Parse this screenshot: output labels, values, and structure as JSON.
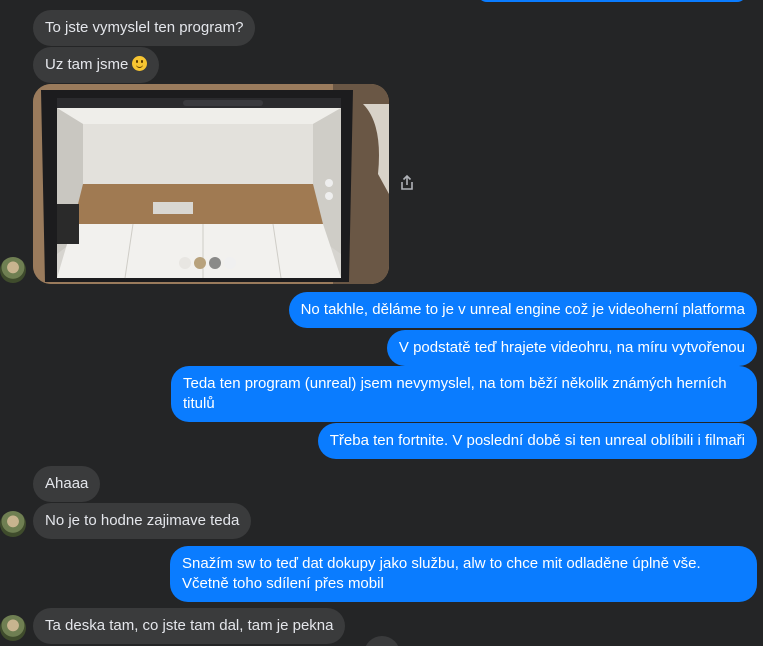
{
  "messages": {
    "m1": "To jste vymyslel ten program?",
    "m2": "Uz tam jsme",
    "m3": "No takhle, děláme to je v unreal engine což je videoherní platforma",
    "m4": "V podstatě teď hrajete videohru, na míru vytvořenou",
    "m5": "Teda ten program (unreal) jsem nevymyslel, na tom běží několik známých herních titulů",
    "m6": "Třeba ten fortnite. V poslední době si ten unreal oblíbili i filmaři",
    "m7": "Ahaaa",
    "m8": "No je to hodne zajimave teda",
    "m9": "Snažím sw to teď dat dokupy jako službu, alw to chce mit odladěne úplně vše. Včetně toho sdílení přes mobil",
    "m10": "Ta deska tam, co jste tam dal, tam je pekna"
  },
  "icons": {
    "emoji": "smiling-face-icon",
    "share": "share-icon"
  },
  "colors": {
    "background": "#242526",
    "incoming_bubble": "#3a3b3c",
    "outgoing_bubble": "#0a7cff",
    "incoming_text": "#e4e6eb",
    "outgoing_text": "#ffffff"
  }
}
